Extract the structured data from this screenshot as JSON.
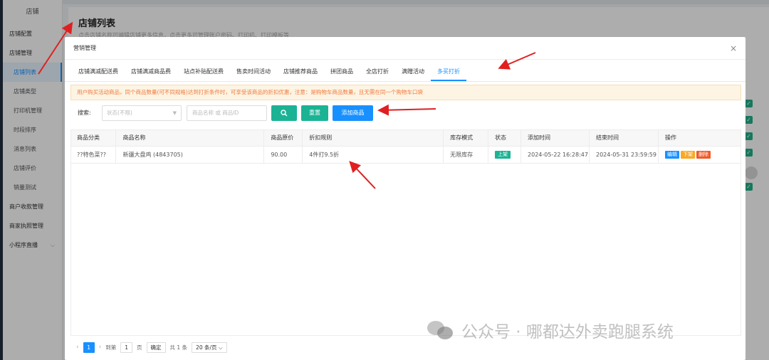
{
  "sidebar": {
    "title": "店铺",
    "items": [
      {
        "label": "店铺配置"
      },
      {
        "label": "店铺管理"
      },
      {
        "label": "店铺列表"
      },
      {
        "label": "店铺类型"
      },
      {
        "label": "打印机管理"
      },
      {
        "label": "时段排序"
      },
      {
        "label": "消息列表"
      },
      {
        "label": "店铺评价"
      },
      {
        "label": "销量测试"
      },
      {
        "label": "商户收款管理"
      },
      {
        "label": "商家执照管理"
      },
      {
        "label": "小程序直播"
      }
    ]
  },
  "background_page": {
    "title": "店铺列表",
    "description": "点击店铺名称可编辑店铺更多信息，点击更多可管理账户密码、打印机、打印模板等"
  },
  "modal": {
    "title": "营销管理",
    "close_icon": "close-icon",
    "tabs": [
      "店铺满减配送费",
      "店铺满减商品费",
      "站点补贴配送费",
      "售卖时间活动",
      "店铺推荐商品",
      "拼团商品",
      "全店打折",
      "满赠活动",
      "多买打折"
    ],
    "active_tab": "多买打折",
    "notice": "用户购买活动商品，同个商品数量(可不同规格)达到打折条件时，可享受该商品的折扣优惠，注意：是购物车商品数量，且无需在同一个购物车口袋",
    "search": {
      "label": "搜索:",
      "status_placeholder": "状态(不限)",
      "keyword_placeholder": "商品名称 或 商品ID",
      "reset_label": "重置",
      "add_label": "添加商品"
    },
    "table": {
      "columns": [
        "商品分类",
        "商品名称",
        "商品原价",
        "折扣规则",
        "库存模式",
        "状态",
        "添加时间",
        "结束时间",
        "操作"
      ],
      "rows": [
        {
          "category": "??特色菜??",
          "name": "新疆大盘鸡 (4843705)",
          "price": "90.00",
          "rule": "4件打9.5折",
          "stock": "无限库存",
          "status": "上架",
          "added": "2024-05-22 16:28:47",
          "ended": "2024-05-31 23:59:59",
          "ops": [
            "编辑",
            "下架",
            "删除"
          ]
        }
      ]
    },
    "pagination": {
      "current_page": "1",
      "goto_label": "到第",
      "page_input": "1",
      "page_unit": "页",
      "confirm_label": "确定",
      "total": "共 1 条",
      "page_size": "20 条/页"
    }
  },
  "watermark": "公众号 · 哪都达外卖跑腿系统",
  "colors": {
    "primary": "#1890ff",
    "success": "#1bb394",
    "warning": "#f9a825",
    "danger": "#f05a28",
    "annotation": "#e02020"
  }
}
